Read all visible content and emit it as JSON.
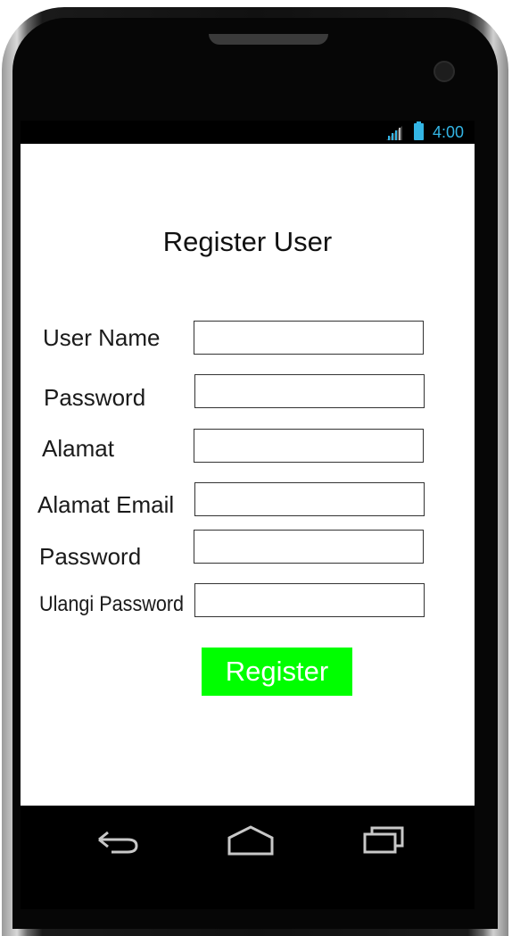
{
  "status_bar": {
    "time": "4:00",
    "icons": [
      "signal-icon",
      "battery-icon"
    ],
    "accent_color": "#33b5e5"
  },
  "page": {
    "title": "Register User"
  },
  "form": {
    "fields": [
      {
        "label": "User Name",
        "value": "",
        "placeholder": ""
      },
      {
        "label": "Password",
        "value": "",
        "placeholder": ""
      },
      {
        "label": "Alamat",
        "value": "",
        "placeholder": ""
      },
      {
        "label": "Alamat Email",
        "value": "",
        "placeholder": ""
      },
      {
        "label": "Password",
        "value": "",
        "placeholder": ""
      },
      {
        "label": "Ulangi Password",
        "value": "",
        "placeholder": ""
      }
    ],
    "submit_label": "Register",
    "submit_color": "#00ff00"
  },
  "nav_bar": {
    "icons": [
      "back-icon",
      "home-icon",
      "recent-apps-icon"
    ]
  }
}
